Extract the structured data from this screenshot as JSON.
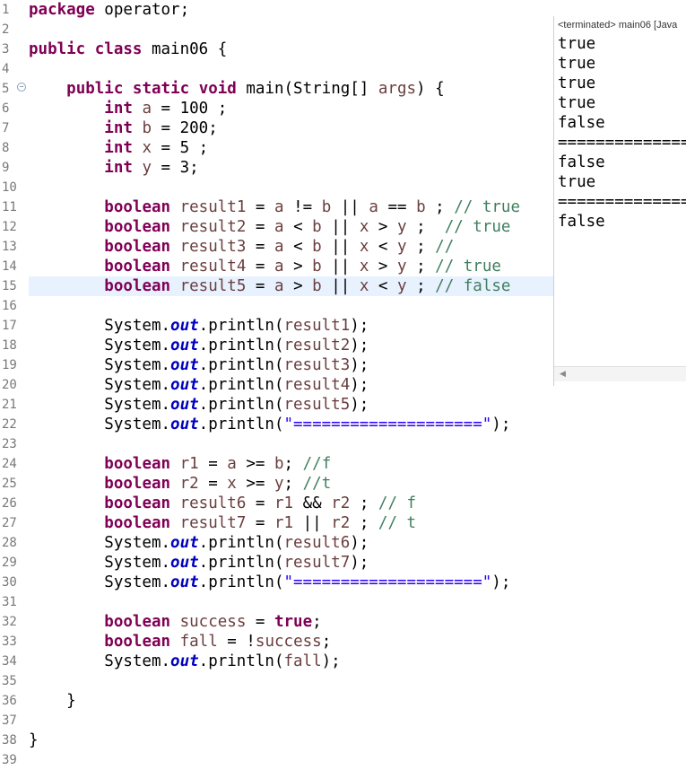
{
  "editor": {
    "lines": [
      {
        "n": "1",
        "tokens": [
          {
            "t": "package",
            "c": "kw"
          },
          {
            "t": " operator;",
            "c": "plain"
          }
        ]
      },
      {
        "n": "2",
        "tokens": []
      },
      {
        "n": "3",
        "tokens": [
          {
            "t": "public",
            "c": "kw"
          },
          {
            "t": " ",
            "c": "plain"
          },
          {
            "t": "class",
            "c": "kw"
          },
          {
            "t": " main06 {",
            "c": "plain"
          }
        ]
      },
      {
        "n": "4",
        "tokens": []
      },
      {
        "n": "5",
        "fold": true,
        "tokens": [
          {
            "t": "    ",
            "c": "plain"
          },
          {
            "t": "public",
            "c": "kw"
          },
          {
            "t": " ",
            "c": "plain"
          },
          {
            "t": "static",
            "c": "kw"
          },
          {
            "t": " ",
            "c": "plain"
          },
          {
            "t": "void",
            "c": "kw"
          },
          {
            "t": " main(String[] ",
            "c": "plain"
          },
          {
            "t": "args",
            "c": "id"
          },
          {
            "t": ") {",
            "c": "plain"
          }
        ]
      },
      {
        "n": "6",
        "tokens": [
          {
            "t": "        ",
            "c": "plain"
          },
          {
            "t": "int",
            "c": "kw"
          },
          {
            "t": " ",
            "c": "plain"
          },
          {
            "t": "a",
            "c": "id"
          },
          {
            "t": " = 100 ;",
            "c": "plain"
          }
        ]
      },
      {
        "n": "7",
        "tokens": [
          {
            "t": "        ",
            "c": "plain"
          },
          {
            "t": "int",
            "c": "kw"
          },
          {
            "t": " ",
            "c": "plain"
          },
          {
            "t": "b",
            "c": "id"
          },
          {
            "t": " = 200;",
            "c": "plain"
          }
        ]
      },
      {
        "n": "8",
        "tokens": [
          {
            "t": "        ",
            "c": "plain"
          },
          {
            "t": "int",
            "c": "kw"
          },
          {
            "t": " ",
            "c": "plain"
          },
          {
            "t": "x",
            "c": "id"
          },
          {
            "t": " = 5 ;",
            "c": "plain"
          }
        ]
      },
      {
        "n": "9",
        "tokens": [
          {
            "t": "        ",
            "c": "plain"
          },
          {
            "t": "int",
            "c": "kw"
          },
          {
            "t": " ",
            "c": "plain"
          },
          {
            "t": "y",
            "c": "id"
          },
          {
            "t": " = 3;",
            "c": "plain"
          }
        ]
      },
      {
        "n": "10",
        "tokens": []
      },
      {
        "n": "11",
        "tokens": [
          {
            "t": "        ",
            "c": "plain"
          },
          {
            "t": "boolean",
            "c": "kw"
          },
          {
            "t": " ",
            "c": "plain"
          },
          {
            "t": "result1",
            "c": "id"
          },
          {
            "t": " = ",
            "c": "plain"
          },
          {
            "t": "a",
            "c": "id"
          },
          {
            "t": " != ",
            "c": "plain"
          },
          {
            "t": "b",
            "c": "id"
          },
          {
            "t": " || ",
            "c": "plain"
          },
          {
            "t": "a",
            "c": "id"
          },
          {
            "t": " == ",
            "c": "plain"
          },
          {
            "t": "b",
            "c": "id"
          },
          {
            "t": " ; ",
            "c": "plain"
          },
          {
            "t": "// true",
            "c": "cm"
          }
        ]
      },
      {
        "n": "12",
        "tokens": [
          {
            "t": "        ",
            "c": "plain"
          },
          {
            "t": "boolean",
            "c": "kw"
          },
          {
            "t": " ",
            "c": "plain"
          },
          {
            "t": "result2",
            "c": "id"
          },
          {
            "t": " = ",
            "c": "plain"
          },
          {
            "t": "a",
            "c": "id"
          },
          {
            "t": " < ",
            "c": "plain"
          },
          {
            "t": "b",
            "c": "id"
          },
          {
            "t": " || ",
            "c": "plain"
          },
          {
            "t": "x",
            "c": "id"
          },
          {
            "t": " > ",
            "c": "plain"
          },
          {
            "t": "y",
            "c": "id"
          },
          {
            "t": " ;  ",
            "c": "plain"
          },
          {
            "t": "// true",
            "c": "cm"
          }
        ]
      },
      {
        "n": "13",
        "tokens": [
          {
            "t": "        ",
            "c": "plain"
          },
          {
            "t": "boolean",
            "c": "kw"
          },
          {
            "t": " ",
            "c": "plain"
          },
          {
            "t": "result3",
            "c": "id"
          },
          {
            "t": " = ",
            "c": "plain"
          },
          {
            "t": "a",
            "c": "id"
          },
          {
            "t": " < ",
            "c": "plain"
          },
          {
            "t": "b",
            "c": "id"
          },
          {
            "t": " || ",
            "c": "plain"
          },
          {
            "t": "x",
            "c": "id"
          },
          {
            "t": " < ",
            "c": "plain"
          },
          {
            "t": "y",
            "c": "id"
          },
          {
            "t": " ; ",
            "c": "plain"
          },
          {
            "t": "//",
            "c": "cm"
          }
        ]
      },
      {
        "n": "14",
        "tokens": [
          {
            "t": "        ",
            "c": "plain"
          },
          {
            "t": "boolean",
            "c": "kw"
          },
          {
            "t": " ",
            "c": "plain"
          },
          {
            "t": "result4",
            "c": "id"
          },
          {
            "t": " = ",
            "c": "plain"
          },
          {
            "t": "a",
            "c": "id"
          },
          {
            "t": " > ",
            "c": "plain"
          },
          {
            "t": "b",
            "c": "id"
          },
          {
            "t": " || ",
            "c": "plain"
          },
          {
            "t": "x",
            "c": "id"
          },
          {
            "t": " > ",
            "c": "plain"
          },
          {
            "t": "y",
            "c": "id"
          },
          {
            "t": " ; ",
            "c": "plain"
          },
          {
            "t": "// true",
            "c": "cm"
          }
        ]
      },
      {
        "n": "15",
        "current": true,
        "tokens": [
          {
            "t": "        ",
            "c": "plain"
          },
          {
            "t": "boolean",
            "c": "kw"
          },
          {
            "t": " ",
            "c": "plain"
          },
          {
            "t": "result5",
            "c": "id"
          },
          {
            "t": " = ",
            "c": "plain"
          },
          {
            "t": "a",
            "c": "id"
          },
          {
            "t": " > ",
            "c": "plain"
          },
          {
            "t": "b",
            "c": "id"
          },
          {
            "t": " || ",
            "c": "plain"
          },
          {
            "t": "x",
            "c": "id"
          },
          {
            "t": " < ",
            "c": "plain"
          },
          {
            "t": "y",
            "c": "id"
          },
          {
            "t": " ; ",
            "c": "plain"
          },
          {
            "t": "// false",
            "c": "cm"
          }
        ]
      },
      {
        "n": "16",
        "tokens": []
      },
      {
        "n": "17",
        "tokens": [
          {
            "t": "        System.",
            "c": "plain"
          },
          {
            "t": "out",
            "c": "fld"
          },
          {
            "t": ".println(",
            "c": "plain"
          },
          {
            "t": "result1",
            "c": "id"
          },
          {
            "t": ");",
            "c": "plain"
          }
        ]
      },
      {
        "n": "18",
        "tokens": [
          {
            "t": "        System.",
            "c": "plain"
          },
          {
            "t": "out",
            "c": "fld"
          },
          {
            "t": ".println(",
            "c": "plain"
          },
          {
            "t": "result2",
            "c": "id"
          },
          {
            "t": ");",
            "c": "plain"
          }
        ]
      },
      {
        "n": "19",
        "tokens": [
          {
            "t": "        System.",
            "c": "plain"
          },
          {
            "t": "out",
            "c": "fld"
          },
          {
            "t": ".println(",
            "c": "plain"
          },
          {
            "t": "result3",
            "c": "id"
          },
          {
            "t": ");",
            "c": "plain"
          }
        ]
      },
      {
        "n": "20",
        "tokens": [
          {
            "t": "        System.",
            "c": "plain"
          },
          {
            "t": "out",
            "c": "fld"
          },
          {
            "t": ".println(",
            "c": "plain"
          },
          {
            "t": "result4",
            "c": "id"
          },
          {
            "t": ");",
            "c": "plain"
          }
        ]
      },
      {
        "n": "21",
        "tokens": [
          {
            "t": "        System.",
            "c": "plain"
          },
          {
            "t": "out",
            "c": "fld"
          },
          {
            "t": ".println(",
            "c": "plain"
          },
          {
            "t": "result5",
            "c": "id"
          },
          {
            "t": ");",
            "c": "plain"
          }
        ]
      },
      {
        "n": "22",
        "tokens": [
          {
            "t": "        System.",
            "c": "plain"
          },
          {
            "t": "out",
            "c": "fld"
          },
          {
            "t": ".println(",
            "c": "plain"
          },
          {
            "t": "\"====================\"",
            "c": "str"
          },
          {
            "t": ");",
            "c": "plain"
          }
        ]
      },
      {
        "n": "23",
        "tokens": []
      },
      {
        "n": "24",
        "tokens": [
          {
            "t": "        ",
            "c": "plain"
          },
          {
            "t": "boolean",
            "c": "kw"
          },
          {
            "t": " ",
            "c": "plain"
          },
          {
            "t": "r1",
            "c": "id"
          },
          {
            "t": " = ",
            "c": "plain"
          },
          {
            "t": "a",
            "c": "id"
          },
          {
            "t": " >= ",
            "c": "plain"
          },
          {
            "t": "b",
            "c": "id"
          },
          {
            "t": "; ",
            "c": "plain"
          },
          {
            "t": "//f",
            "c": "cm"
          }
        ]
      },
      {
        "n": "25",
        "tokens": [
          {
            "t": "        ",
            "c": "plain"
          },
          {
            "t": "boolean",
            "c": "kw"
          },
          {
            "t": " ",
            "c": "plain"
          },
          {
            "t": "r2",
            "c": "id"
          },
          {
            "t": " = ",
            "c": "plain"
          },
          {
            "t": "x",
            "c": "id"
          },
          {
            "t": " >= ",
            "c": "plain"
          },
          {
            "t": "y",
            "c": "id"
          },
          {
            "t": "; ",
            "c": "plain"
          },
          {
            "t": "//t",
            "c": "cm"
          }
        ]
      },
      {
        "n": "26",
        "tokens": [
          {
            "t": "        ",
            "c": "plain"
          },
          {
            "t": "boolean",
            "c": "kw"
          },
          {
            "t": " ",
            "c": "plain"
          },
          {
            "t": "result6",
            "c": "id"
          },
          {
            "t": " = ",
            "c": "plain"
          },
          {
            "t": "r1",
            "c": "id"
          },
          {
            "t": " && ",
            "c": "plain"
          },
          {
            "t": "r2",
            "c": "id"
          },
          {
            "t": " ; ",
            "c": "plain"
          },
          {
            "t": "// f",
            "c": "cm"
          }
        ]
      },
      {
        "n": "27",
        "tokens": [
          {
            "t": "        ",
            "c": "plain"
          },
          {
            "t": "boolean",
            "c": "kw"
          },
          {
            "t": " ",
            "c": "plain"
          },
          {
            "t": "result7",
            "c": "id"
          },
          {
            "t": " = ",
            "c": "plain"
          },
          {
            "t": "r1",
            "c": "id"
          },
          {
            "t": " || ",
            "c": "plain"
          },
          {
            "t": "r2",
            "c": "id"
          },
          {
            "t": " ; ",
            "c": "plain"
          },
          {
            "t": "// t",
            "c": "cm"
          }
        ]
      },
      {
        "n": "28",
        "tokens": [
          {
            "t": "        System.",
            "c": "plain"
          },
          {
            "t": "out",
            "c": "fld"
          },
          {
            "t": ".println(",
            "c": "plain"
          },
          {
            "t": "result6",
            "c": "id"
          },
          {
            "t": ");",
            "c": "plain"
          }
        ]
      },
      {
        "n": "29",
        "tokens": [
          {
            "t": "        System.",
            "c": "plain"
          },
          {
            "t": "out",
            "c": "fld"
          },
          {
            "t": ".println(",
            "c": "plain"
          },
          {
            "t": "result7",
            "c": "id"
          },
          {
            "t": ");",
            "c": "plain"
          }
        ]
      },
      {
        "n": "30",
        "tokens": [
          {
            "t": "        System.",
            "c": "plain"
          },
          {
            "t": "out",
            "c": "fld"
          },
          {
            "t": ".println(",
            "c": "plain"
          },
          {
            "t": "\"====================\"",
            "c": "str"
          },
          {
            "t": ");",
            "c": "plain"
          }
        ]
      },
      {
        "n": "31",
        "tokens": []
      },
      {
        "n": "32",
        "tokens": [
          {
            "t": "        ",
            "c": "plain"
          },
          {
            "t": "boolean",
            "c": "kw"
          },
          {
            "t": " ",
            "c": "plain"
          },
          {
            "t": "success",
            "c": "id"
          },
          {
            "t": " = ",
            "c": "plain"
          },
          {
            "t": "true",
            "c": "kw"
          },
          {
            "t": ";",
            "c": "plain"
          }
        ]
      },
      {
        "n": "33",
        "tokens": [
          {
            "t": "        ",
            "c": "plain"
          },
          {
            "t": "boolean",
            "c": "kw"
          },
          {
            "t": " ",
            "c": "plain"
          },
          {
            "t": "fall",
            "c": "id"
          },
          {
            "t": " = !",
            "c": "plain"
          },
          {
            "t": "success",
            "c": "id"
          },
          {
            "t": ";",
            "c": "plain"
          }
        ]
      },
      {
        "n": "34",
        "tokens": [
          {
            "t": "        System.",
            "c": "plain"
          },
          {
            "t": "out",
            "c": "fld"
          },
          {
            "t": ".println(",
            "c": "plain"
          },
          {
            "t": "fall",
            "c": "id"
          },
          {
            "t": ");",
            "c": "plain"
          }
        ]
      },
      {
        "n": "35",
        "tokens": []
      },
      {
        "n": "36",
        "tokens": [
          {
            "t": "    }",
            "c": "plain"
          }
        ]
      },
      {
        "n": "37",
        "tokens": []
      },
      {
        "n": "38",
        "tokens": [
          {
            "t": "}",
            "c": "plain"
          }
        ]
      },
      {
        "n": "39",
        "tokens": []
      }
    ]
  },
  "console": {
    "title": "<terminated> main06 [Java",
    "lines": [
      "true",
      "true",
      "true",
      "true",
      "false",
      "==============",
      "false",
      "true",
      "==============",
      "false"
    ]
  },
  "colors": {
    "keyword": "#7f0055",
    "identifier": "#6a3e3e",
    "field": "#0000c0",
    "string": "#2a00ff",
    "comment": "#3f7f5f",
    "current_line": "#e8f2fe"
  }
}
